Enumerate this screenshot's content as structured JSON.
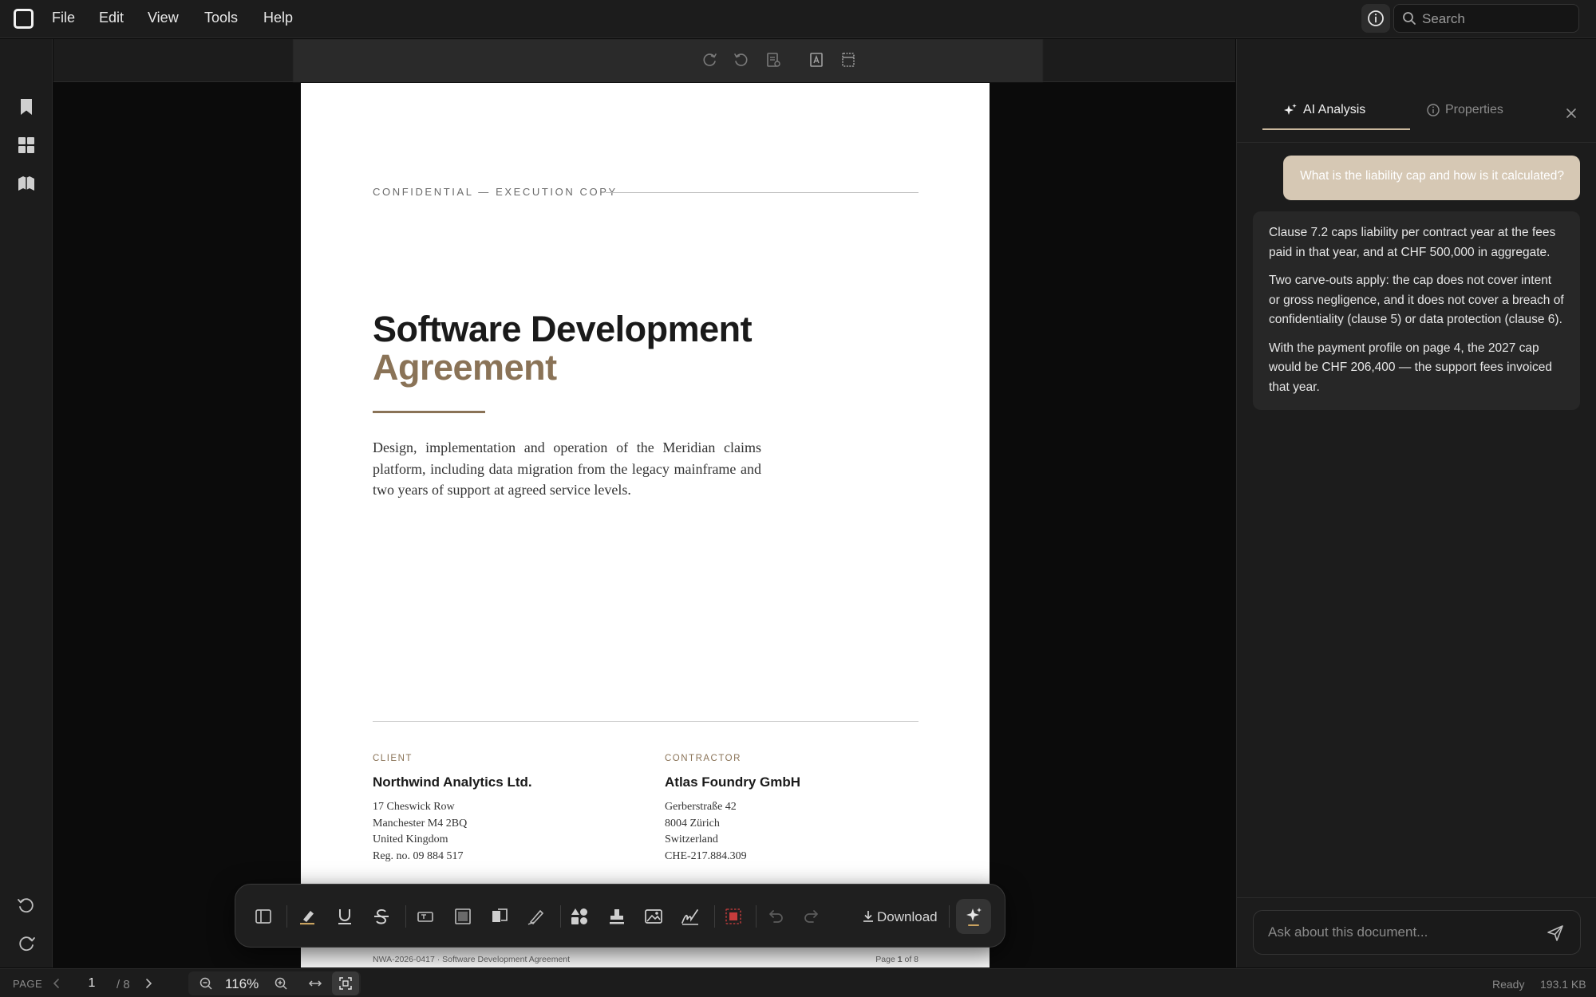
{
  "menubar": {
    "items": [
      "File",
      "Edit",
      "View",
      "Tools",
      "Help"
    ],
    "search_placeholder": "Search"
  },
  "document": {
    "kicker": "CONFIDENTIAL — EXECUTION COPY",
    "title_line1": "Software Development",
    "title_line2": "Agreement",
    "summary": "Design, implementation and operation of the Meridian claims platform, including data migration from the legacy mainframe and two years of support at agreed service levels.",
    "client": {
      "role": "CLIENT",
      "name": "Northwind Analytics Ltd.",
      "lines": [
        "17 Cheswick Row",
        "Manchester M4 2BQ",
        "United Kingdom",
        "Reg. no. 09 884 517"
      ]
    },
    "contractor": {
      "role": "CONTRACTOR",
      "name": "Atlas Foundry GmbH",
      "lines": [
        "Gerberstraße 42",
        "8004 Zürich",
        "Switzerland",
        "CHE-217.884.309"
      ]
    },
    "footer_left": "NWA-2026-0417 · Software Development Agreement",
    "footer_page_prefix": "Page",
    "footer_page_num": "1",
    "footer_page_suffix": "of 8",
    "accent_color": "#8a7357"
  },
  "toolbar": {
    "download_label": "Download"
  },
  "panel": {
    "tab_ai": "AI Analysis",
    "tab_properties": "Properties",
    "user_question": "What is the liability cap and how is it calculated?",
    "answer_paragraphs": [
      "Clause 7.2 caps liability per contract year at the fees paid in that year, and at CHF 500,000 in aggregate.",
      "Two carve-outs apply: the cap does not cover intent or gross negligence, and it does not cover a breach of confidentiality (clause 5) or data protection (clause 6).",
      "With the payment profile on page 4, the 2027 cap would be CHF 206,400 — the support fees invoiced that year."
    ],
    "ask_placeholder": "Ask about this document..."
  },
  "statusbar": {
    "page_label": "PAGE",
    "current_page": "1",
    "total_pages": "/ 8",
    "zoom": "116%",
    "status": "Ready",
    "file_size": "193.1 KB"
  }
}
